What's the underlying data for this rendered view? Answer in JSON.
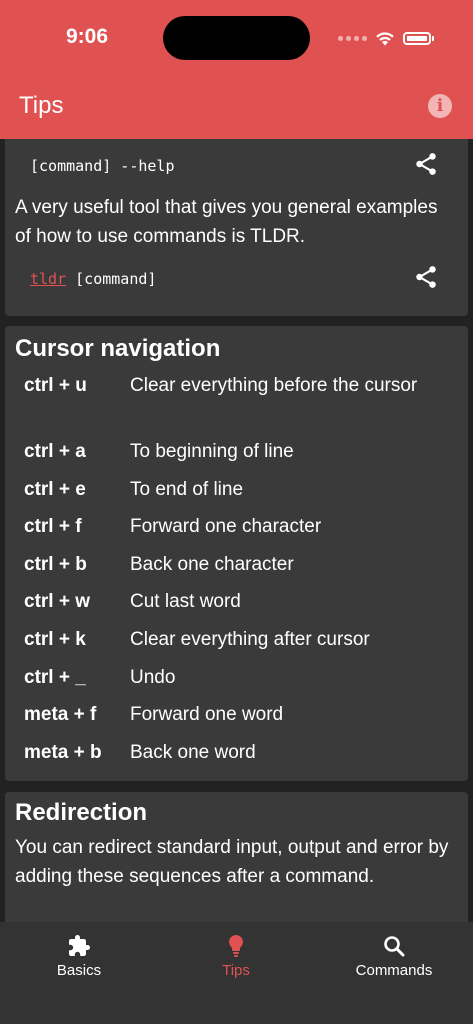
{
  "status_bar": {
    "time": "9:06"
  },
  "header": {
    "title": "Tips",
    "info_icon": "info-icon"
  },
  "help_card": {
    "help_command": "[command] --help",
    "tldr_text": "A very useful tool that gives you general examples of how to use commands is TLDR.",
    "tldr_link": "tldr",
    "tldr_arg": " [command]"
  },
  "cursor_navigation": {
    "title": "Cursor navigation",
    "rows": [
      {
        "key": "ctrl + u",
        "desc": "Clear everything before the cursor"
      },
      {
        "key": "ctrl + a",
        "desc": "To beginning of line"
      },
      {
        "key": "ctrl + e",
        "desc": "To end of line"
      },
      {
        "key": "ctrl + f",
        "desc": "Forward one character"
      },
      {
        "key": "ctrl + b",
        "desc": "Back one character"
      },
      {
        "key": "ctrl + w",
        "desc": "Cut last word"
      },
      {
        "key": "ctrl + k",
        "desc": "Clear everything after cursor"
      },
      {
        "key": "ctrl + _",
        "desc": "Undo"
      },
      {
        "key": "meta + f",
        "desc": "Forward one word"
      },
      {
        "key": "meta + b",
        "desc": "Back one word"
      }
    ]
  },
  "redirection": {
    "title": "Redirection",
    "text": "You can redirect standard input, output and error by adding these sequences after a command."
  },
  "bottom_nav": {
    "items": [
      {
        "label": "Basics",
        "icon": "puzzle-icon"
      },
      {
        "label": "Tips",
        "icon": "lightbulb-icon",
        "active": true
      },
      {
        "label": "Commands",
        "icon": "search-icon"
      }
    ]
  },
  "colors": {
    "accent": "#e05252",
    "card": "#3a3a3a",
    "background": "#222222",
    "nav": "#333333"
  }
}
